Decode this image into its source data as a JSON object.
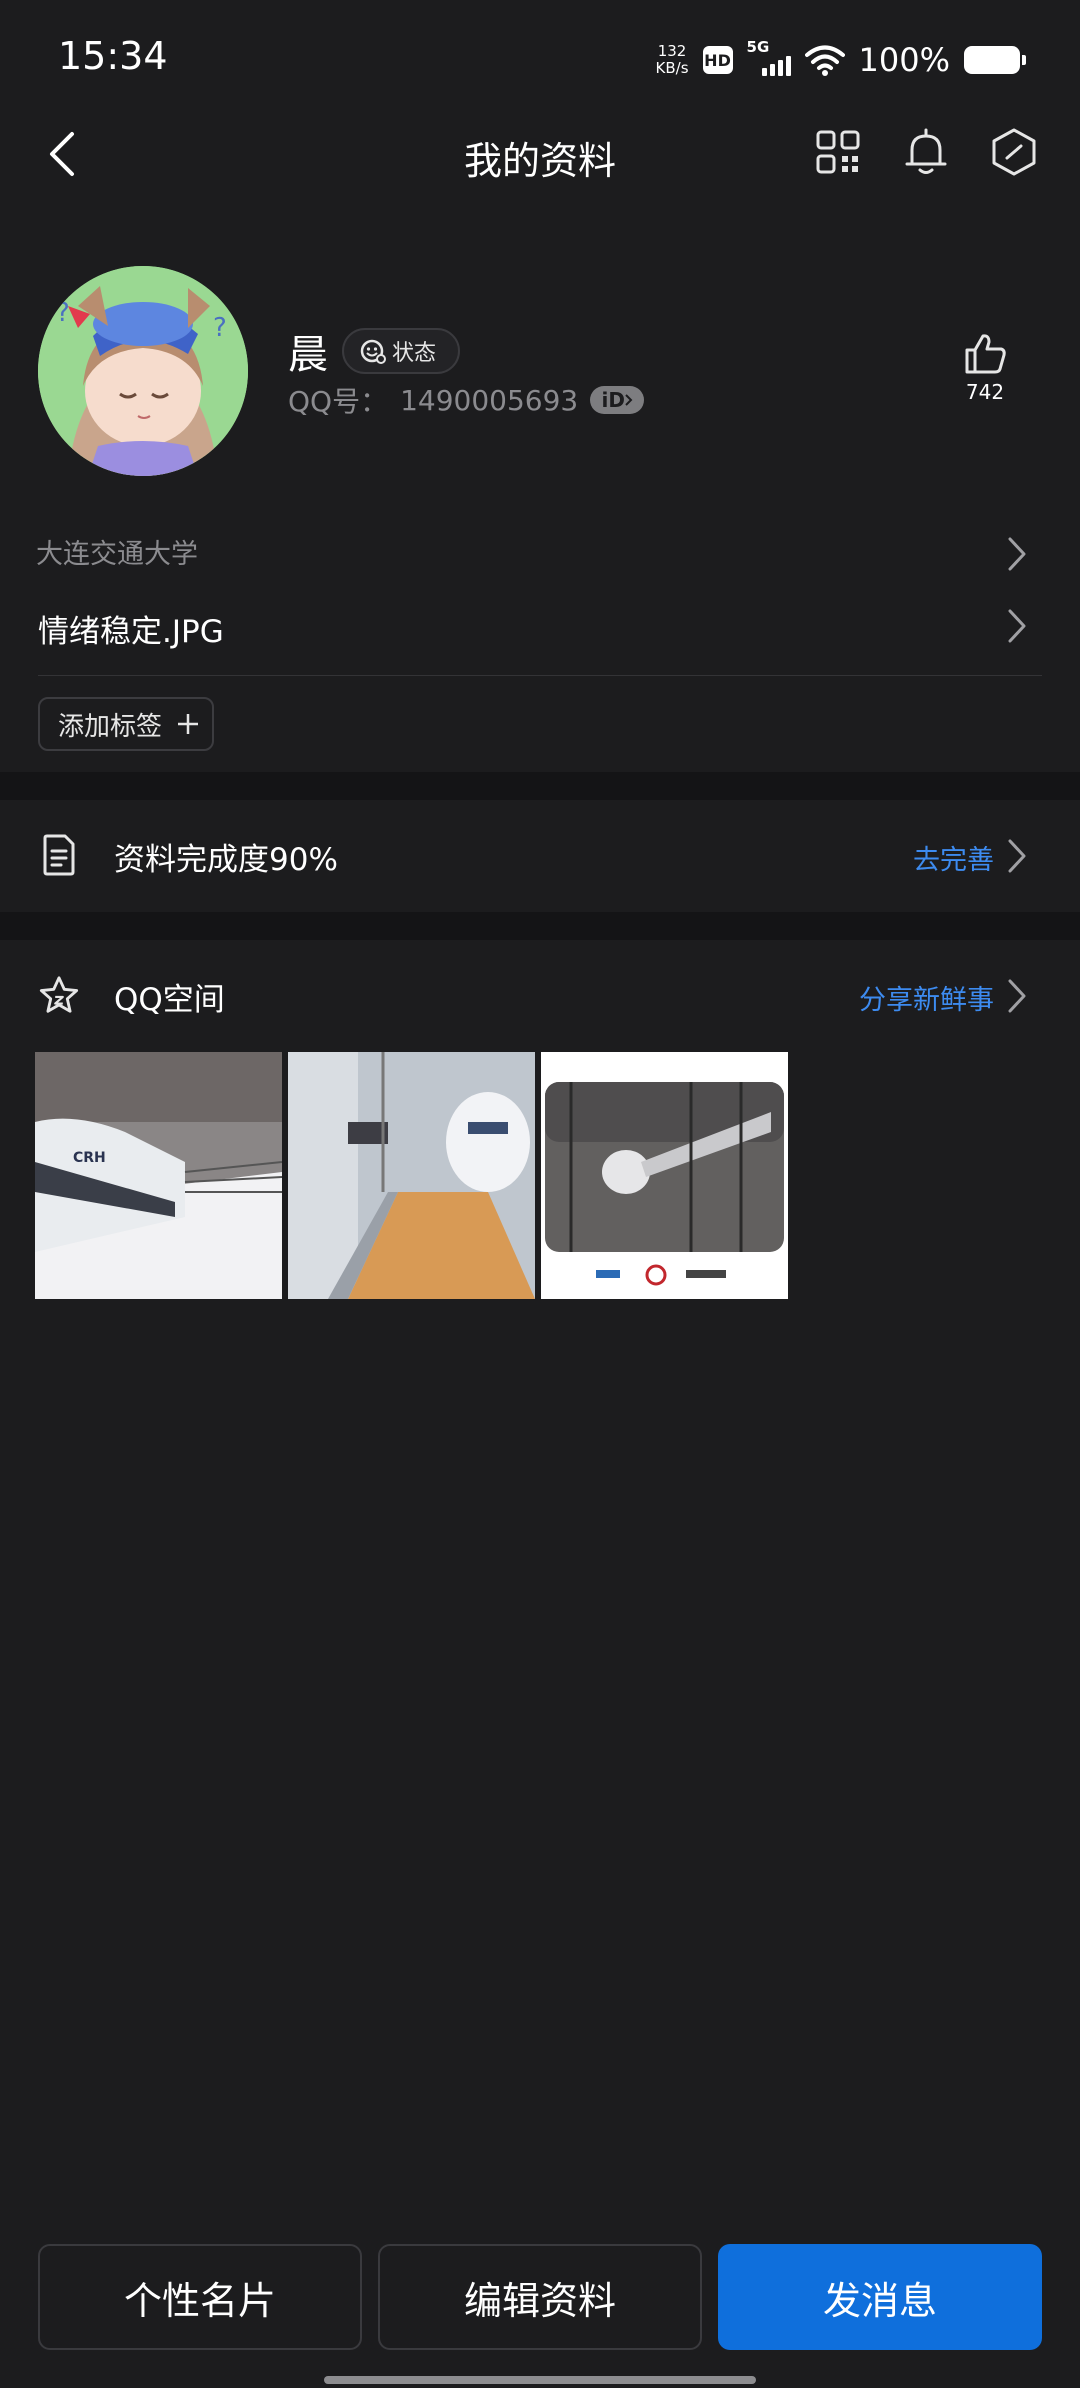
{
  "status_bar": {
    "time": "15:34",
    "net_speed_value": "132",
    "net_speed_unit": "KB/s",
    "hd": "HD",
    "network": "5G",
    "battery": "100%"
  },
  "nav": {
    "title": "我的资料",
    "icons": [
      "back-icon",
      "qr-code-icon",
      "bell-icon",
      "hexagon-icon"
    ]
  },
  "profile": {
    "name": "晨",
    "status_label": "状态",
    "qq_label": "QQ号：",
    "qq_number": "1490005693",
    "id_badge": "iD",
    "like_count": "742"
  },
  "info": {
    "school": "大连交通大学",
    "mood": "情绪稳定.JPG",
    "add_tag": "添加标签"
  },
  "completeness": {
    "title": "资料完成度90%",
    "action": "去完善"
  },
  "qzone": {
    "title": "QQ空间",
    "action": "分享新鲜事",
    "photo_labels": [
      "CRH"
    ]
  },
  "bottom": {
    "card_btn": "个性名片",
    "edit_btn": "编辑资料",
    "message_btn": "发消息"
  },
  "colors": {
    "background": "#1c1c1e",
    "accent": "#3d8bf0",
    "primary_button": "#0f6fdc"
  }
}
